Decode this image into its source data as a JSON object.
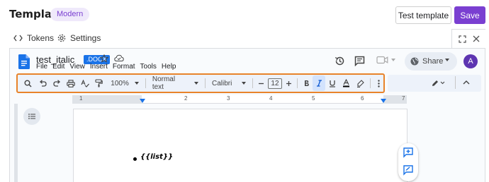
{
  "header": {
    "title": "Template",
    "badge": "Modern",
    "test_button": "Test template",
    "save_button": "Save"
  },
  "tabs": [
    {
      "label": "Tokens",
      "icon": "code-icon"
    },
    {
      "label": "Settings",
      "icon": "gear-icon"
    }
  ],
  "doc": {
    "title": "test_italic",
    "file_badge": ".DOCX",
    "menu": [
      "File",
      "Edit",
      "View",
      "Insert",
      "Format",
      "Tools",
      "Help"
    ],
    "share_label": "Share",
    "avatar_letter": "A",
    "toolbar": {
      "zoom": "100%",
      "style": "Normal text",
      "font": "Calibri",
      "font_size": "12"
    },
    "ruler_numbers": [
      "1",
      "2",
      "3",
      "4",
      "5",
      "6",
      "7"
    ],
    "body_text": "{{list}}"
  },
  "colors": {
    "accent": "#7a3fd1",
    "toolbar_highlight": "#e8832a",
    "docs_blue": "#1a73e8"
  }
}
